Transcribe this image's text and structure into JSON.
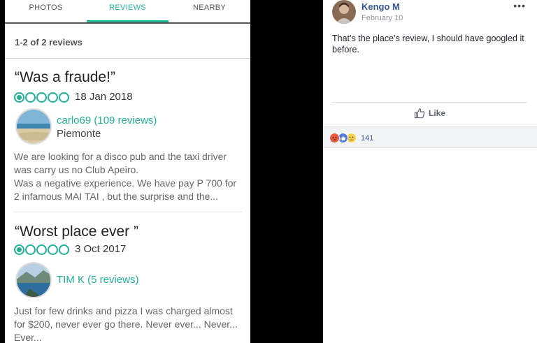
{
  "tabs": [
    {
      "label": "PHOTOS"
    },
    {
      "label": "REVIEWS"
    },
    {
      "label": "NEARBY"
    }
  ],
  "review_count": "1-2 of 2 reviews",
  "reviews": [
    {
      "title": "“Was a fraude!”",
      "rating": 1,
      "rating_max": 5,
      "date": "18 Jan 2018",
      "user": "carlo69 (109 reviews)",
      "location": "Piemonte",
      "body_lines": [
        "We are looking for a disco pub and the taxi driver",
        "was carry us no Club Apeiro.",
        "Was a negative experience. We have pay P 700 for",
        "2 infamous MAI TAI , but the surprise and the..."
      ]
    },
    {
      "title": "“Worst place ever ”",
      "rating": 1,
      "rating_max": 5,
      "date": "3 Oct 2017",
      "user": "TIM K (5 reviews)",
      "location": "",
      "body_lines": [
        "Just for few drinks and pizza I was charged almost",
        "for $200, never ever go there. Never ever... Never...",
        "Ever..."
      ]
    }
  ],
  "post": {
    "author": "Kengo M",
    "date": "February 10",
    "more": "•••",
    "text_lines": [
      "That’s the place’s review, I should have googled it",
      "before."
    ],
    "like_label": "Like",
    "reaction_count": "141",
    "reaction_icons": [
      "angry-icon",
      "like-icon",
      "sad-icon"
    ]
  },
  "colors": {
    "accent": "#1fb396",
    "fb_link": "#365899"
  }
}
